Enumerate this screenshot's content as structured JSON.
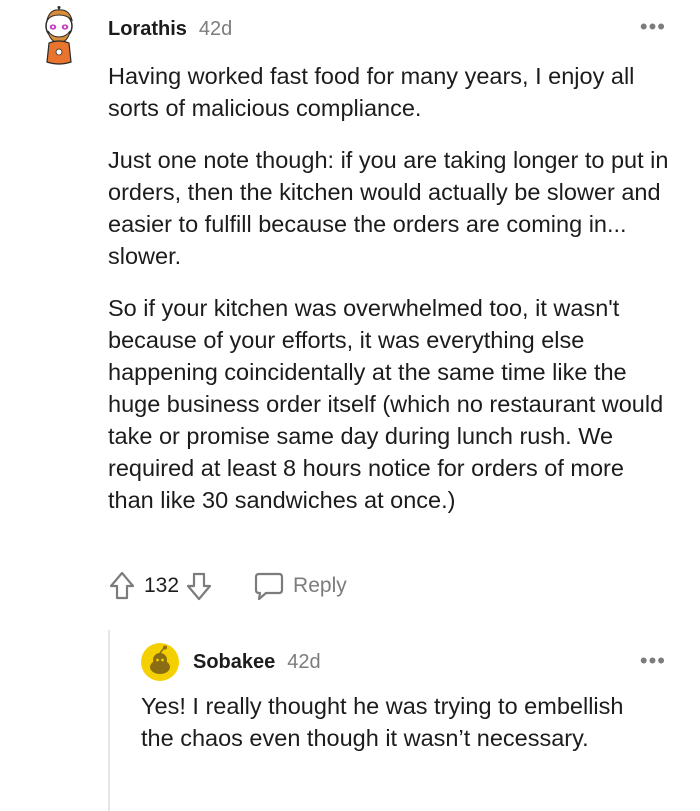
{
  "comments": [
    {
      "username": "Lorathis",
      "age": "42d",
      "paragraphs": [
        "Having worked fast food for many years, I enjoy all sorts of malicious compliance.",
        "Just one note though: if you are taking longer to put in orders, then the kitchen would actually be slower and easier to fulfill because the orders are coming in... slower.",
        "So if your kitchen was overwhelmed too, it wasn't because of your efforts, it was everything else happening coincidentally at the same time like the huge business order itself (which no restaurant would take or promise same day during lunch rush. We required at least 8 hours notice for orders of more than like 30 sandwiches at once.)"
      ],
      "score": "132",
      "reply_label": "Reply",
      "more_label": "•••"
    },
    {
      "username": "Sobakee",
      "age": "42d",
      "paragraphs": [
        "Yes! I really thought he was trying to embellish the chaos even though it wasn’t necessary."
      ],
      "more_label": "•••"
    }
  ],
  "icons": {
    "upvote": "upvote-arrow-icon",
    "downvote": "downvote-arrow-icon",
    "reply": "speech-bubble-icon"
  },
  "colors": {
    "text": "#1c1c1c",
    "meta": "#7c7c7c",
    "thread_line": "#e6e6e6",
    "avatar2_bg": "#f5d000"
  }
}
